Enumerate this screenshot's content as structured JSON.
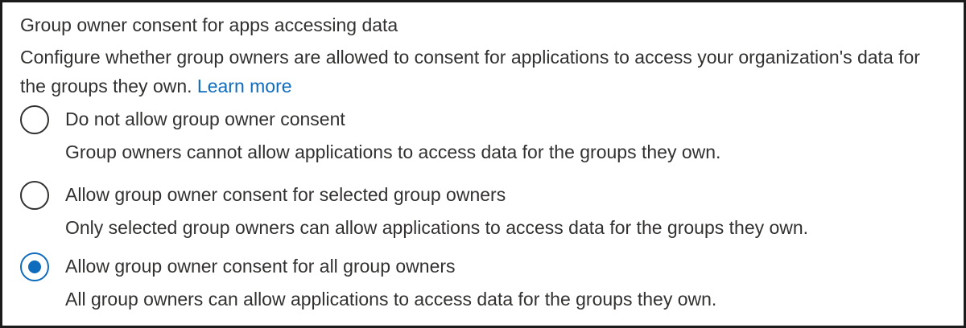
{
  "section": {
    "title": "Group owner consent for apps accessing data",
    "description": "Configure whether group owners are allowed to consent for applications to access your organization's data for the groups they own.",
    "learn_more": "Learn more"
  },
  "options": [
    {
      "label": "Do not allow group owner consent",
      "description": "Group owners cannot allow applications to access data for the groups they own.",
      "selected": false
    },
    {
      "label": "Allow group owner consent for selected group owners",
      "description": "Only selected group owners can allow applications to access data for the groups they own.",
      "selected": false
    },
    {
      "label": "Allow group owner consent for all group owners",
      "description": "All group owners can allow applications to access data for the groups they own.",
      "selected": true
    }
  ],
  "colors": {
    "accent": "#0f6cbd",
    "text": "#323130",
    "border": "#1b1b1b"
  }
}
